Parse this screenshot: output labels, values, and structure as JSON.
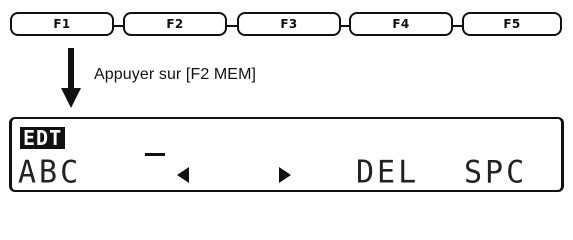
{
  "function_keys": [
    {
      "label": "F1"
    },
    {
      "label": "F2"
    },
    {
      "label": "F3"
    },
    {
      "label": "F4"
    },
    {
      "label": "F5"
    }
  ],
  "instruction": "Appuyer sur [F2 MEM]",
  "lcd": {
    "mode_badge": "EDT",
    "items": [
      {
        "label": "ABC"
      },
      {
        "label": "",
        "icon": "left-triangle-icon"
      },
      {
        "label": "",
        "icon": "right-triangle-icon"
      },
      {
        "label": "DEL"
      },
      {
        "label": "SPC"
      }
    ]
  }
}
